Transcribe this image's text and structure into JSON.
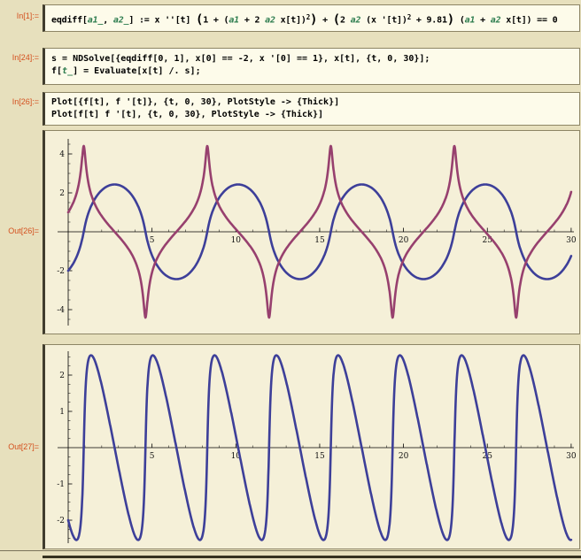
{
  "theme": {
    "page_bg": "#e7e0bd",
    "cell_bg": "#fdfbea",
    "output_bg": "#f5f0d8",
    "cell_border": "#8d8565",
    "cell_border_left": "#413d2e",
    "label_color": "#d4501e",
    "pattern_color": "#2e7d4f",
    "code_color": "#000000"
  },
  "labels": {
    "in1": "In[1]:=",
    "in24": "In[24]:=",
    "in26": "In[26]:=",
    "out26": "Out[26]=",
    "out27": "Out[27]="
  },
  "code": {
    "in1": [
      [
        {
          "t": "eqdiff[",
          "s": "k"
        },
        {
          "t": "a1_",
          "s": "p"
        },
        {
          "t": ", ",
          "s": "k"
        },
        {
          "t": "a2_",
          "s": "p"
        },
        {
          "t": "] := x ''[t] ",
          "s": "k"
        },
        {
          "t": "(",
          "s": "big"
        },
        {
          "t": "1 + (",
          "s": "k"
        },
        {
          "t": "a1",
          "s": "p"
        },
        {
          "t": " + 2 ",
          "s": "k"
        },
        {
          "t": "a2",
          "s": "p"
        },
        {
          "t": " x[t])",
          "s": "k"
        },
        {
          "t": "2",
          "s": "sup"
        },
        {
          "t": ")",
          "s": "big"
        },
        {
          "t": " + ",
          "s": "k"
        },
        {
          "t": "(",
          "s": "big"
        },
        {
          "t": "2 ",
          "s": "k"
        },
        {
          "t": "a2",
          "s": "p"
        },
        {
          "t": " (x '[t])",
          "s": "k"
        },
        {
          "t": "2",
          "s": "sup"
        },
        {
          "t": " + 9.81",
          "s": "k"
        },
        {
          "t": ")",
          "s": "big"
        },
        {
          "t": " (",
          "s": "k"
        },
        {
          "t": "a1",
          "s": "p"
        },
        {
          "t": " + ",
          "s": "k"
        },
        {
          "t": "a2",
          "s": "p"
        },
        {
          "t": " x[t]) == 0",
          "s": "k"
        }
      ]
    ],
    "in24": [
      [
        {
          "t": "s = NDSolve[{eqdiff[0, 1], x[0] == -2, x '[0] == 1}, x[t], {t, 0, 30}];",
          "s": "k"
        }
      ],
      [
        {
          "t": "f[",
          "s": "k"
        },
        {
          "t": "t_",
          "s": "p"
        },
        {
          "t": "] = Evaluate[x[t] /. s];",
          "s": "k"
        }
      ]
    ],
    "in26": [
      [
        {
          "t": "Plot[{f[t], f '[t]}, {t, 0, 30}, PlotStyle -> {Thick}]",
          "s": "k"
        }
      ],
      [
        {
          "t": "Plot[f[t] f '[t], {t, 0, 30}, PlotStyle -> {Thick}]",
          "s": "k"
        }
      ]
    ]
  },
  "chart_data": [
    {
      "type": "line",
      "source_label": "Out[26]=",
      "x": {
        "range": [
          0,
          30
        ],
        "major_ticks": [
          5,
          10,
          15,
          20,
          25,
          30
        ],
        "minor_tick_step": 1
      },
      "y": {
        "major_ticks": [
          -4,
          -2,
          2,
          4
        ],
        "minor_tick_step": 0.5,
        "minor_tick_extent": 4.5
      },
      "series": [
        {
          "name": "f[t]",
          "color": "#3d3f99",
          "thickness": "Thick",
          "description": "position x(t): smooth oscillation, amplitude ~2.43, period ~7.55, starts at -2 rising"
        },
        {
          "name": "f '[t]",
          "color": "#97406e",
          "thickness": "Thick",
          "description": "velocity x'(t): sharp spikes to about +-4.4 at each zero crossing of x"
        }
      ],
      "generator": {
        "model": "NDSolve solution of x''(1+4x^2)+(2x'^2+9.81)x==0",
        "g": 9.81,
        "a1": 0,
        "a2": 1,
        "x0": -2,
        "v0": 1,
        "t_max": 30
      }
    },
    {
      "type": "line",
      "source_label": "Out[27]=",
      "x": {
        "range": [
          0,
          30
        ],
        "major_ticks": [
          5,
          10,
          15,
          20,
          25,
          30
        ],
        "minor_tick_step": 1
      },
      "y": {
        "major_ticks": [
          -2,
          -1,
          1,
          2
        ],
        "minor_tick_step": 0.25,
        "minor_tick_extent": 2.5
      },
      "series": [
        {
          "name": "f[t] f '[t]",
          "color": "#3d3f99",
          "thickness": "Thick",
          "description": "product x(t)x'(t): oscillation with peaks ~+-2.55, period ~3.8, starts at -2"
        }
      ],
      "generator": {
        "same_ode_as_first_plot": true,
        "transform": "x*v"
      }
    }
  ]
}
